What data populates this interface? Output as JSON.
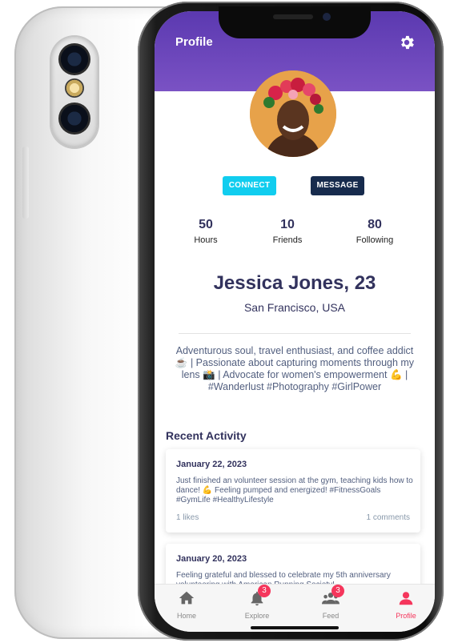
{
  "header": {
    "title": "Profile"
  },
  "profile": {
    "connect_label": "CONNECT",
    "message_label": "MESSAGE",
    "stats": [
      {
        "value": "50",
        "label": "Hours"
      },
      {
        "value": "10",
        "label": "Friends"
      },
      {
        "value": "80",
        "label": "Following"
      }
    ],
    "name": "Jessica Jones, 23",
    "location": "San Francisco, USA",
    "bio": "Adventurous soul, travel enthusiast, and coffee addict ☕ | Passionate about capturing moments through my lens 📸 | Advocate for women's empowerment 💪 | #Wanderlust #Photography #GirlPower"
  },
  "recent_activity": {
    "title": "Recent Activity",
    "items": [
      {
        "date": "January 22, 2023",
        "text": "Just finished an volunteer session at the gym, teaching kids how to dance! 💪 Feeling pumped and energized! #FitnessGoals #GymLife #HealthyLifestyle",
        "likes": "1 likes",
        "comments": "1 comments"
      },
      {
        "date": "January 20, 2023",
        "text": "Feeling grateful and blessed to celebrate my 5th anniversary volunteering with American Running Society!"
      }
    ]
  },
  "tabbar": {
    "items": [
      {
        "label": "Home",
        "icon": "home-icon"
      },
      {
        "label": "Explore",
        "icon": "bell-icon",
        "badge": "3"
      },
      {
        "label": "Feed",
        "icon": "people-icon",
        "badge": "3"
      },
      {
        "label": "Profile",
        "icon": "user-icon"
      }
    ]
  },
  "colors": {
    "header": "#5b39b0",
    "connect": "#11cdef",
    "message": "#172b4d",
    "active": "#f5365c"
  }
}
